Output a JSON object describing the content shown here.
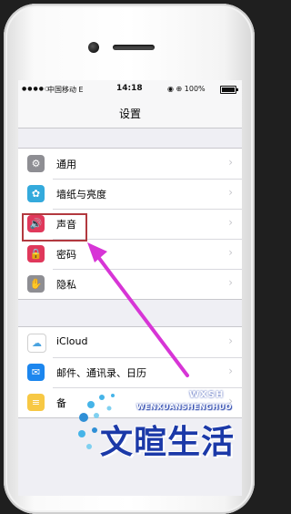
{
  "status_bar": {
    "signal": "●●●●○",
    "carrier": "中国移动 E",
    "time": "14:18",
    "right": "◉ ⊕ 100%",
    "battery_level": 1.0
  },
  "nav": {
    "title": "设置"
  },
  "groups": [
    [
      {
        "label": "通用",
        "icon": "gear-icon",
        "glyph": "⚙",
        "color": "#8e8e93"
      },
      {
        "label": "墙纸与亮度",
        "icon": "flower-icon",
        "glyph": "✿",
        "color": "#34aadc"
      },
      {
        "label": "声音",
        "icon": "speaker-icon",
        "glyph": "🔊",
        "color": "#e0385b"
      },
      {
        "label": "密码",
        "icon": "lock-icon",
        "glyph": "🔒",
        "color": "#e0385b"
      },
      {
        "label": "隐私",
        "icon": "hand-icon",
        "glyph": "✋",
        "color": "#8e8e93"
      }
    ],
    [
      {
        "label": "iCloud",
        "icon": "cloud-icon",
        "glyph": "☁",
        "color": "#ffffff"
      },
      {
        "label": "邮件、通讯录、日历",
        "icon": "mail-icon",
        "glyph": "✉",
        "color": "#1c86ee"
      },
      {
        "label": "备",
        "icon": "notes-icon",
        "glyph": "≡",
        "color": "#f7c844"
      }
    ]
  ],
  "chevron": "›",
  "watermark": {
    "mark": "WXSH",
    "pinyin": "WENXUANSHENGHUO",
    "brand": "文暄生活",
    "accent": "#1b39a8"
  },
  "annotation": {
    "highlight_color": "#b2393f",
    "arrow_color": "#d735d6"
  }
}
